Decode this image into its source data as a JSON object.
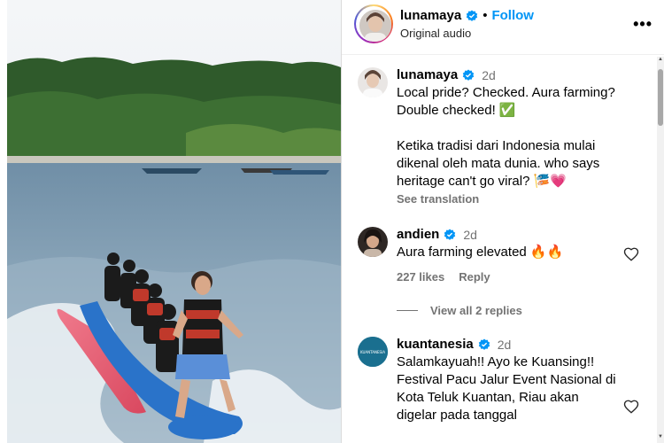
{
  "header": {
    "username": "lunamaya",
    "follow_label": "Follow",
    "separator": "•",
    "audio": "Original audio",
    "more_glyph": "•••"
  },
  "caption": {
    "username": "lunamaya",
    "time": "2d",
    "text": "Local pride? Checked. Aura farming? Double checked! ✅\n\nKetika tradisi dari Indonesia mulai dikenal oleh mata dunia. who says heritage can't go viral? 🎏💗",
    "see_translation": "See translation"
  },
  "comments": [
    {
      "username": "andien",
      "time": "2d",
      "text": "Aura farming elevated 🔥🔥",
      "likes": "227 likes",
      "reply_label": "Reply",
      "view_replies": "View all 2 replies"
    },
    {
      "username": "kuantanesia",
      "time": "2d",
      "text": "Salamkayuah!! Ayo ke Kuansing!! Festival Pacu Jalur Event Nasional di Kota Teluk Kuantan, Riau akan digelar pada tanggal",
      "avatar_text": "KUANTANESIA"
    }
  ],
  "icons": {
    "verified": "verified-badge-icon",
    "heart": "heart-outline-icon",
    "more": "more-options-icon"
  },
  "colors": {
    "follow_blue": "#0095f6",
    "verified_blue": "#0095f6",
    "secondary_text": "#737373",
    "kuantanesia_avatar": "#1a6f8f"
  }
}
